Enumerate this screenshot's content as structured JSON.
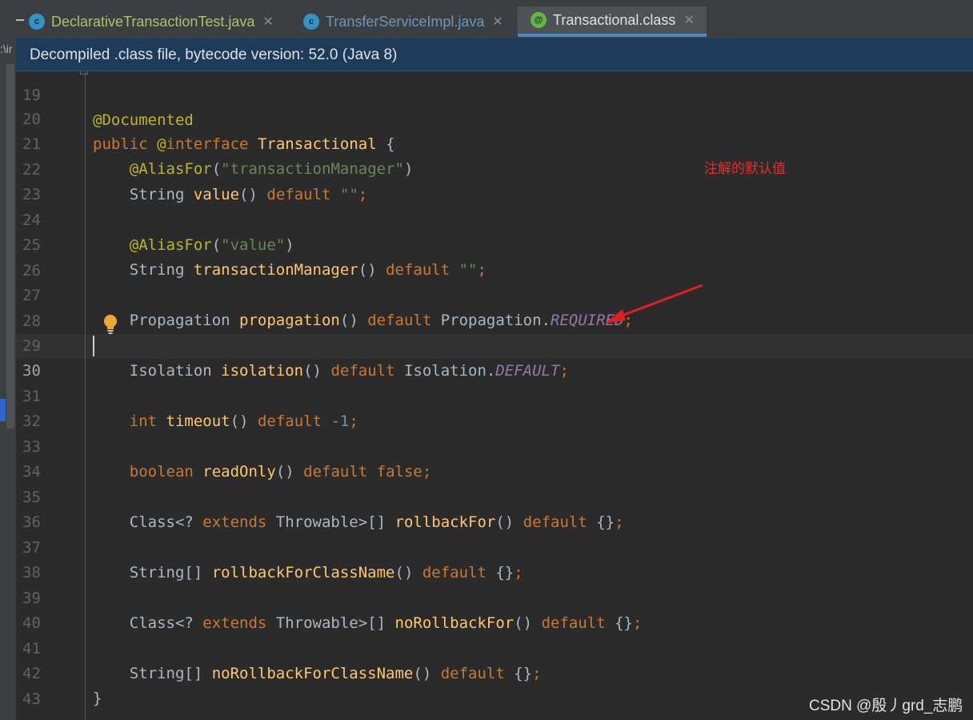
{
  "tabs": [
    {
      "label": "DeclarativeTransactionTest.java",
      "icon": "c"
    },
    {
      "label": "TransferServiceImpl.java",
      "icon": "c"
    },
    {
      "label": "Transactional.class",
      "icon": "@"
    }
  ],
  "path_fragment": ":\\ir",
  "banner": "Decompiled .class file, bytecode version: 52.0 (Java 8)",
  "lines": [
    {
      "n": "19",
      "code": "@Documented"
    },
    {
      "n": "20",
      "code": "public @interface Transactional {"
    },
    {
      "n": "21",
      "code": "    @AliasFor(\"transactionManager\")"
    },
    {
      "n": "22",
      "code": "    String value() default \"\";"
    },
    {
      "n": "23",
      "code": ""
    },
    {
      "n": "24",
      "code": "    @AliasFor(\"value\")"
    },
    {
      "n": "25",
      "code": "    String transactionManager() default \"\";"
    },
    {
      "n": "26",
      "code": ""
    },
    {
      "n": "27",
      "code": "    Propagation propagation() default Propagation.REQUIRED;"
    },
    {
      "n": "28",
      "code": ""
    },
    {
      "n": "29",
      "code": "    Isolation isolation() default Isolation.DEFAULT;"
    },
    {
      "n": "30",
      "code": ""
    },
    {
      "n": "31",
      "code": "    int timeout() default -1;"
    },
    {
      "n": "32",
      "code": ""
    },
    {
      "n": "33",
      "code": "    boolean readOnly() default false;"
    },
    {
      "n": "34",
      "code": ""
    },
    {
      "n": "35",
      "code": "    Class<? extends Throwable>[] rollbackFor() default {};"
    },
    {
      "n": "36",
      "code": ""
    },
    {
      "n": "37",
      "code": "    String[] rollbackForClassName() default {};"
    },
    {
      "n": "38",
      "code": ""
    },
    {
      "n": "39",
      "code": "    Class<? extends Throwable>[] noRollbackFor() default {};"
    },
    {
      "n": "40",
      "code": ""
    },
    {
      "n": "41",
      "code": "    String[] noRollbackForClassName() default {};"
    },
    {
      "n": "42",
      "code": "}"
    },
    {
      "n": "43",
      "code": ""
    }
  ],
  "annotation_note": "注解的默认值",
  "watermark": "CSDN @殷丿grd_志鹏",
  "colors": {
    "accent": "#4a88c7",
    "banner_bg": "#1f3b5a",
    "note": "#e03030"
  }
}
